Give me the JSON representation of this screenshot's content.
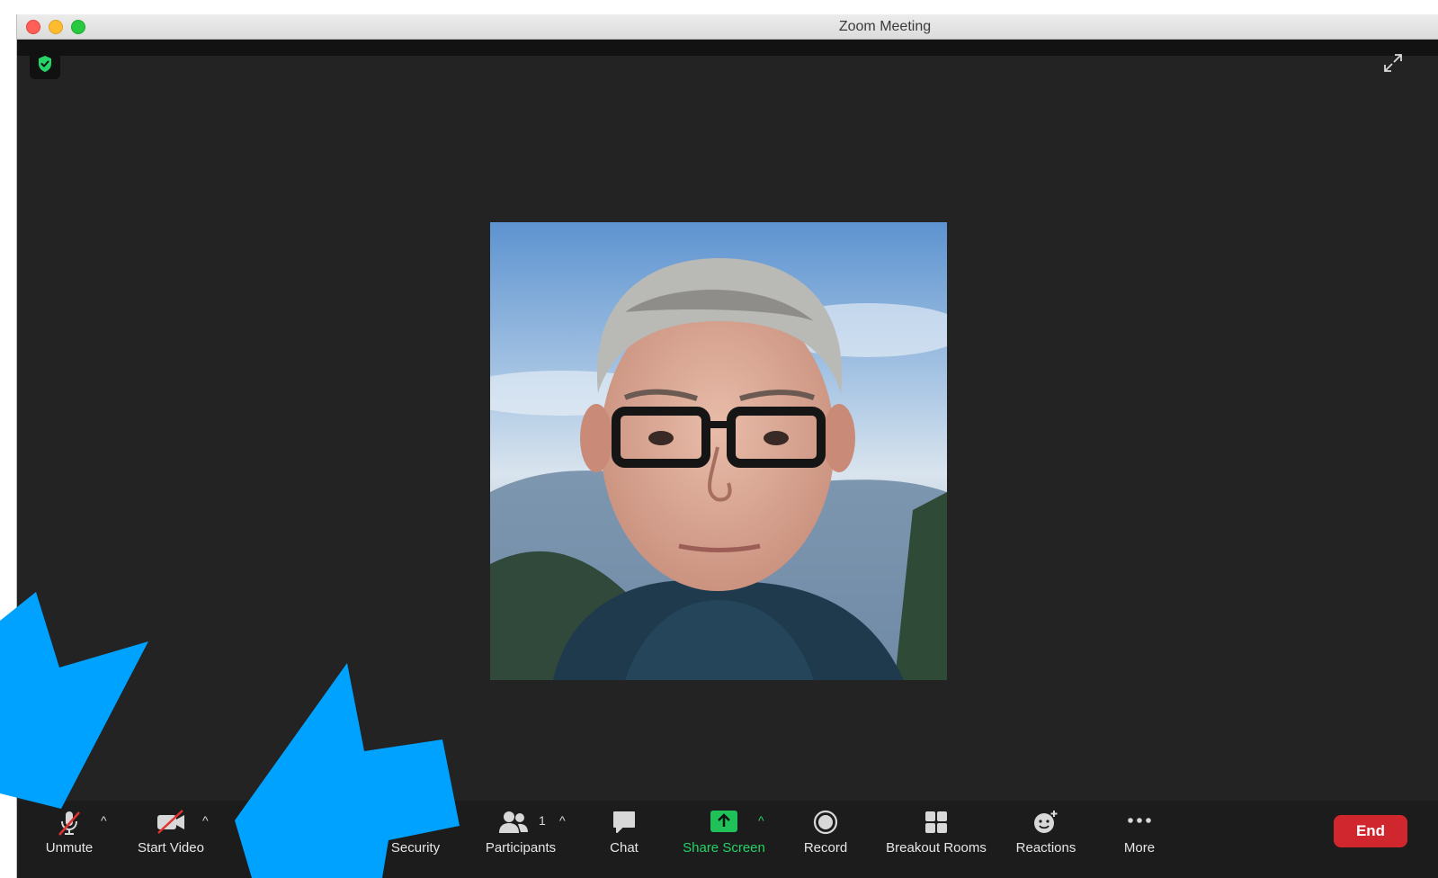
{
  "window": {
    "title": "Zoom Meeting"
  },
  "colors": {
    "background": "#232323",
    "toolbar": "#1c1c1c",
    "accent_green": "#25d366",
    "end_red": "#d0262d",
    "annotation_blue": "#00a2ff"
  },
  "toolbar": {
    "unmute": {
      "label": "Unmute",
      "icon": "microphone-muted-icon"
    },
    "start_video": {
      "label": "Start Video",
      "icon": "video-camera-off-icon"
    },
    "security": {
      "label": "Security",
      "icon": "shield-icon"
    },
    "participants": {
      "label": "Participants",
      "count": "1",
      "icon": "participants-icon"
    },
    "chat": {
      "label": "Chat",
      "icon": "chat-bubble-icon"
    },
    "share_screen": {
      "label": "Share Screen",
      "icon": "share-screen-icon"
    },
    "record": {
      "label": "Record",
      "icon": "record-icon"
    },
    "breakout_rooms": {
      "label": "Breakout Rooms",
      "icon": "grid-icon"
    },
    "reactions": {
      "label": "Reactions",
      "icon": "smiley-add-icon"
    },
    "more": {
      "label": "More",
      "icon": "more-dots-icon"
    },
    "end": {
      "label": "End"
    }
  },
  "video": {
    "participant_icon": "participant-video-tile"
  }
}
